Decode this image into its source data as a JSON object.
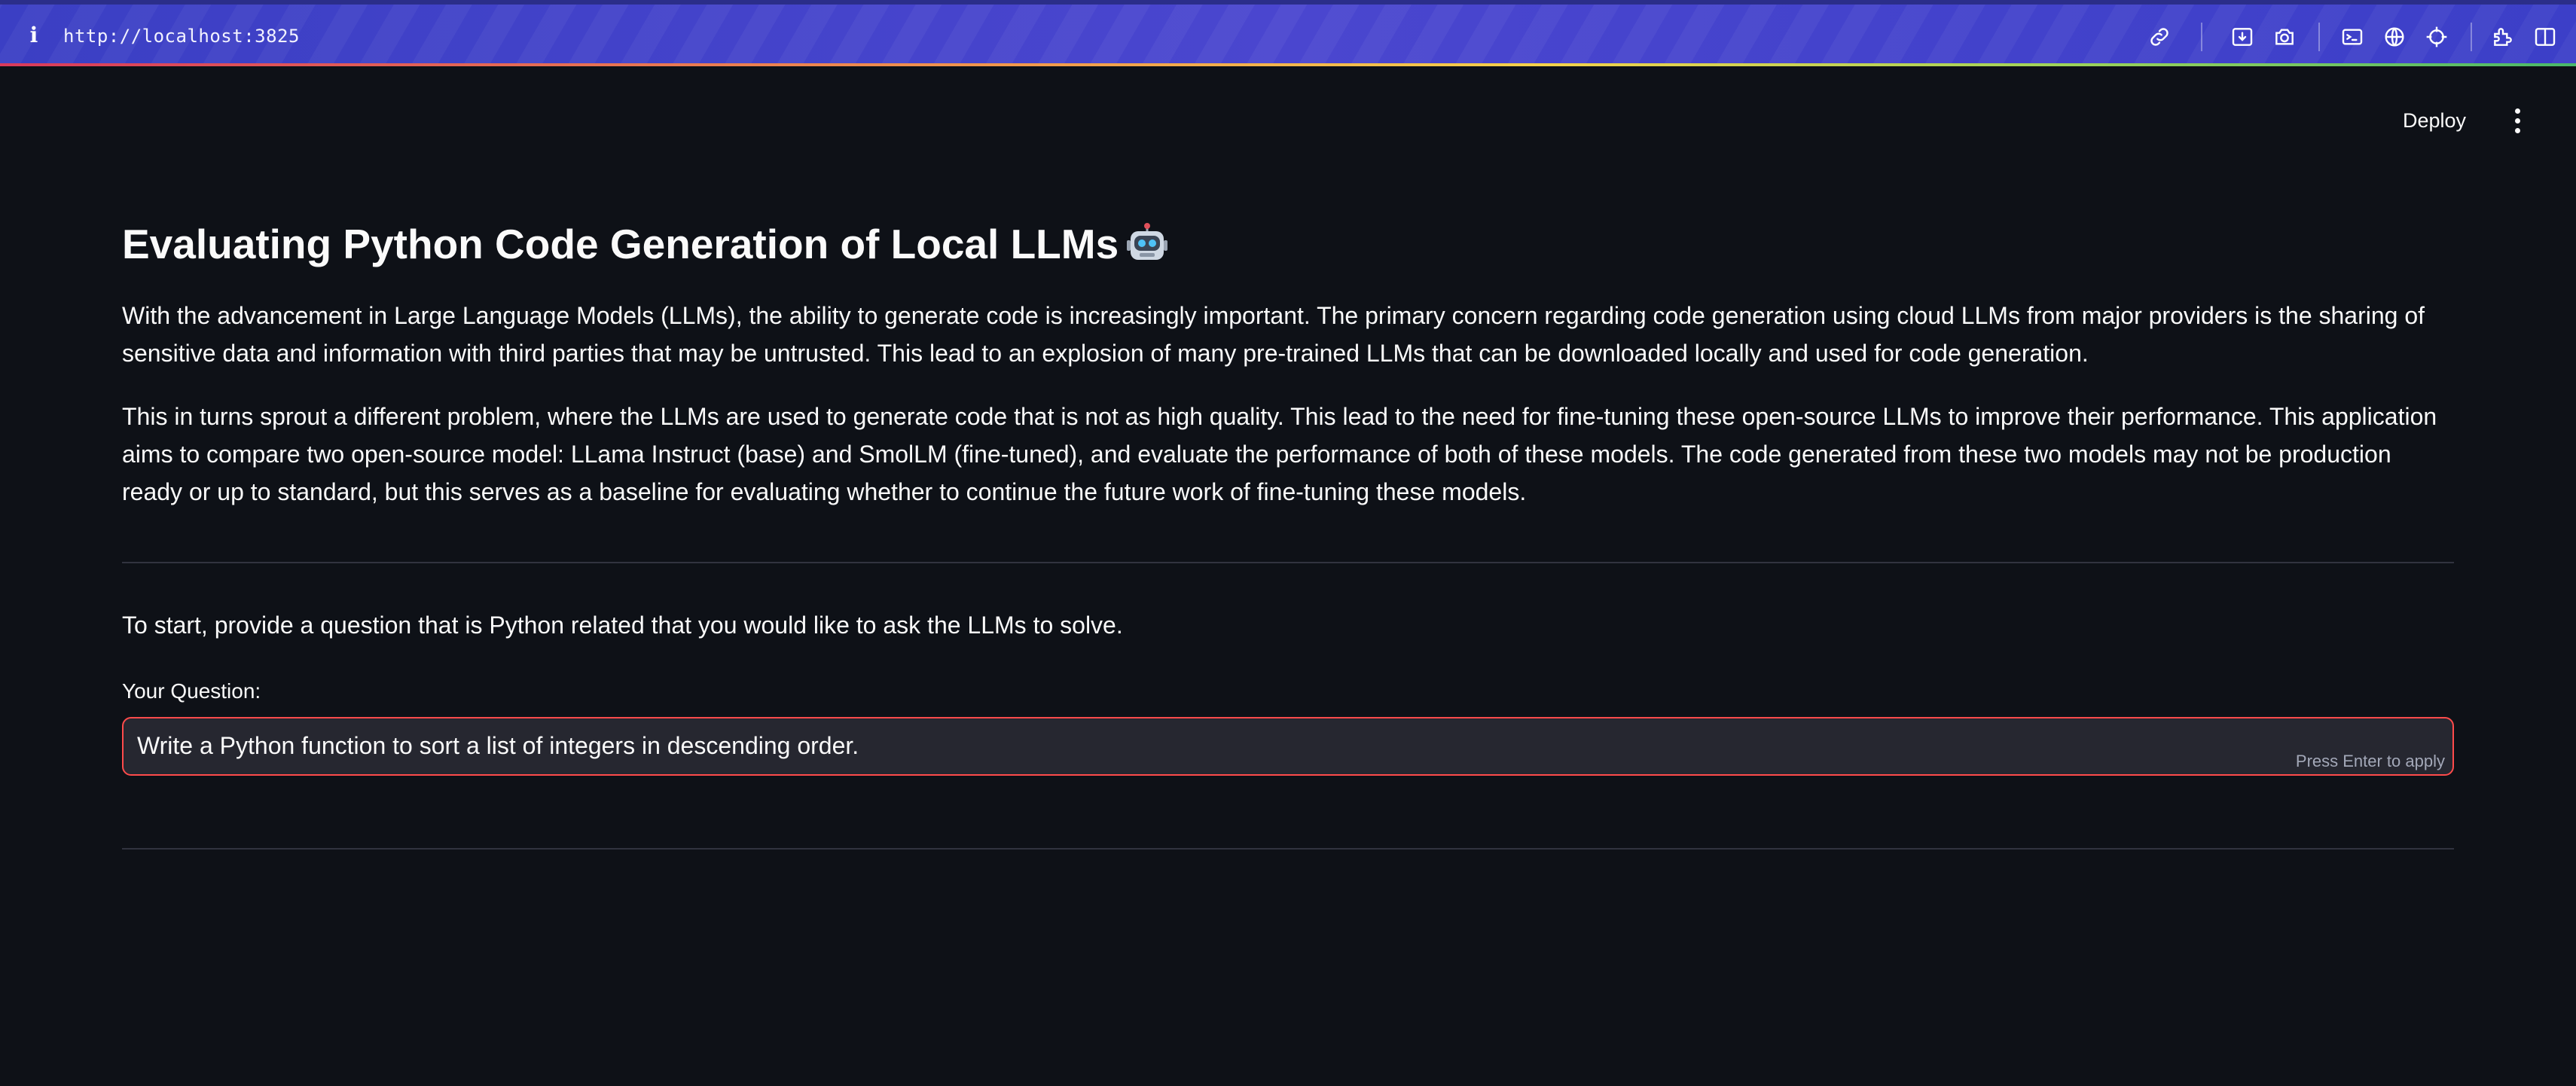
{
  "browser": {
    "info_glyph": "i",
    "url": "http://localhost:3825",
    "toolbar_icons": [
      "link-icon",
      "download-icon",
      "camera-icon",
      "terminal-icon",
      "globe-icon",
      "crosshair-icon",
      "extension-icon",
      "sidebar-icon"
    ]
  },
  "header": {
    "deploy_label": "Deploy",
    "menu_icon": "more-vertical-icon"
  },
  "main": {
    "title": "Evaluating Python Code Generation of Local LLMs",
    "title_icon": "robot-emoji-icon",
    "paragraph_1": "With the advancement in Large Language Models (LLMs), the ability to generate code is increasingly important. The primary concern regarding code generation using cloud LLMs from major providers is the sharing of sensitive data and information with third parties that may be untrusted. This lead to an explosion of many pre-trained LLMs that can be downloaded locally and used for code generation.",
    "paragraph_2": "This in turns sprout a different problem, where the LLMs are used to generate code that is not as high quality. This lead to the need for fine-tuning these open-source LLMs to improve their performance. This application aims to compare two open-source model: LLama Instruct (base) and SmolLM (fine-tuned), and evaluate the performance of both of these models. The code generated from these two models may not be production ready or up to standard, but this serves as a baseline for evaluating whether to continue the future work of fine-tuning these models.",
    "prompt": "To start, provide a question that is Python related that you would like to ask the LLMs to solve.",
    "question_label": "Your Question:",
    "question_value": "Write a Python function to sort a list of integers in descending order.",
    "enter_hint": "Press Enter to apply"
  },
  "colors": {
    "background": "#0e1117",
    "text": "#fafafa",
    "input_background": "#262730",
    "input_border_focus": "#ff4b4b",
    "browser_bar": "#4a46cf"
  }
}
